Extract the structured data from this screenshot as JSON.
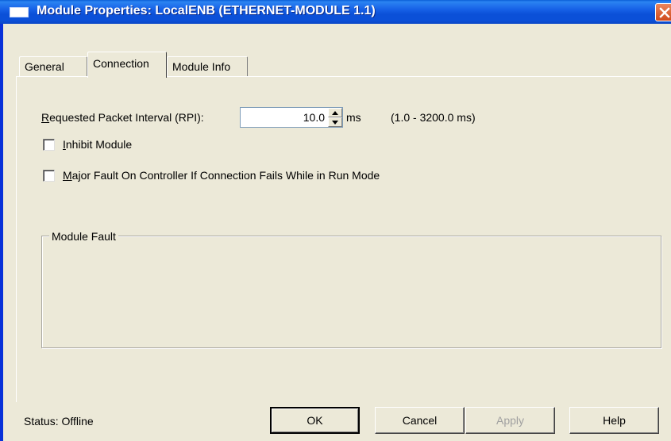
{
  "window": {
    "title": "Module Properties: LocalENB (ETHERNET-MODULE 1.1)"
  },
  "tabs": [
    {
      "label": "General",
      "active": false
    },
    {
      "label": "Connection",
      "active": true
    },
    {
      "label": "Module Info",
      "active": false
    }
  ],
  "rpi": {
    "label_accel": "R",
    "label_rest": "equested Packet Interval (RPI):",
    "value": "10.0",
    "unit": "ms",
    "range": "(1.0 - 3200.0 ms)"
  },
  "inhibit": {
    "label_accel": "I",
    "label_rest": "nhibit Module",
    "checked": false
  },
  "major_fault": {
    "label_accel": "M",
    "label_rest": "ajor Fault On Controller If Connection Fails While in Run Mode",
    "checked": false
  },
  "module_fault": {
    "legend": "Module Fault"
  },
  "status": {
    "text": "Status:  Offline"
  },
  "buttons": {
    "ok": "OK",
    "cancel": "Cancel",
    "apply": "Apply",
    "help": "Help"
  },
  "colors": {
    "titlebar": "#0b50d8",
    "dialog_bg": "#ece9d8",
    "close": "#d04a1c"
  }
}
